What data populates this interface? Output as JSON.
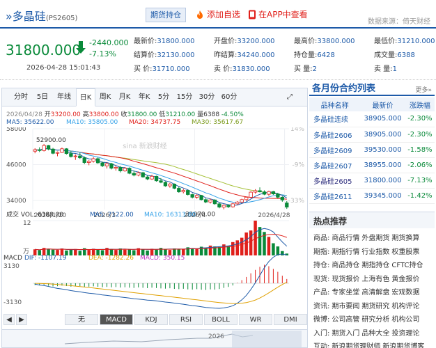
{
  "header": {
    "title": "多晶硅",
    "symbol": "(PS2605)",
    "tag": "期货持仓",
    "add": "添加自选",
    "app": "在APP中查看",
    "source": "数据来源：倚天财经"
  },
  "price": {
    "last": "31800.000",
    "change": "-2440.000",
    "pct": "-7.13%",
    "time": "2026-04-28 15:01:43"
  },
  "quotes": [
    [
      {
        "label": "最新价:",
        "value": "31800.000"
      },
      {
        "label": "开盘价:",
        "value": "33200.000"
      },
      {
        "label": "最高价:",
        "value": "33800.000"
      },
      {
        "label": "最低价:",
        "value": "31210.000"
      }
    ],
    [
      {
        "label": "结算价:",
        "value": "32130.000"
      },
      {
        "label": "昨结算:",
        "value": "34240.000"
      },
      {
        "label": "持仓量:",
        "value": "6428"
      },
      {
        "label": "成交量:",
        "value": "6388"
      }
    ],
    [
      {
        "label": "买 价:",
        "value": "31710.000"
      },
      {
        "label": "卖 价:",
        "value": "31830.000"
      },
      {
        "label": "买 量:",
        "value": "2"
      },
      {
        "label": "卖 量:",
        "value": "1"
      }
    ]
  ],
  "tabs": [
    "分时",
    "5日",
    "年线",
    "日K",
    "周K",
    "月K",
    "年K",
    "5分",
    "15分",
    "30分",
    "60分"
  ],
  "active_tab": "日K",
  "kinfo": {
    "date": "2026/04/28",
    "open_l": "开",
    "open": "33200.00",
    "high_l": "高",
    "high": "33800.00",
    "close_l": "收",
    "close": "31800.00",
    "low_l": "低",
    "low": "31210.00",
    "vol_l": "量",
    "vol": "6388",
    "pct": "-4.50%",
    "ma5": "MA5: 35622.00",
    "ma10": "MA10: 35805.00",
    "ma20": "MA20: 34737.75",
    "ma30": "MA30: 35617.67"
  },
  "vol_legend": {
    "vol": "成交 VOL: 6388.00",
    "ma5": "MA5: 7122.00",
    "ma10": "MA10: 16313.80"
  },
  "macd_legend": {
    "name": "MACD",
    "dif": "DIF: -1107.19",
    "dea": "DEA: -1282.26",
    "macd": "MACD: 350.15"
  },
  "watermark": "sina 新浪财经",
  "indicators": [
    "无",
    "MACD",
    "KDJ",
    "RSI",
    "BOLL",
    "WR",
    "DMI"
  ],
  "active_indicator": "MACD",
  "nav_year": "2026",
  "chart_data": {
    "type": "candlestick",
    "price_axis": {
      "ticks": [
        "58000",
        "46000",
        "34000"
      ],
      "pct_ticks": [
        "14%",
        "-9%",
        "-33%"
      ]
    },
    "x_ticks": [
      "2026/1/20",
      "2026/3",
      "2026/4",
      "2026/4/28"
    ],
    "annotations": [
      {
        "text": "52900.00"
      },
      {
        "text": "31070.00"
      }
    ],
    "vol_axis": {
      "ticks": [
        "12",
        "万"
      ]
    },
    "macd_axis": {
      "ticks": [
        "3130",
        "0",
        "-3130"
      ]
    },
    "candles": [
      [
        50500,
        51500,
        49800,
        51000
      ],
      [
        51000,
        51800,
        50200,
        50700
      ],
      [
        50700,
        52900,
        50400,
        52400
      ],
      [
        52400,
        52600,
        50800,
        51200
      ],
      [
        51200,
        51600,
        49500,
        49800
      ],
      [
        49800,
        50400,
        48800,
        50100
      ],
      [
        50100,
        51700,
        49900,
        51300
      ],
      [
        51300,
        51500,
        49400,
        49700
      ],
      [
        49700,
        50600,
        48400,
        48700
      ],
      [
        48700,
        49400,
        47600,
        48900
      ],
      [
        48900,
        50000,
        47900,
        48300
      ],
      [
        48300,
        48700,
        46200,
        46700
      ],
      [
        46700,
        47500,
        45800,
        47100
      ],
      [
        47100,
        48500,
        46700,
        48000
      ],
      [
        48000,
        48400,
        46300,
        46600
      ],
      [
        46600,
        47000,
        45200,
        45600
      ],
      [
        45600,
        46800,
        44700,
        46300
      ],
      [
        46300,
        46600,
        44400,
        44800
      ],
      [
        44800,
        45700,
        44000,
        45100
      ],
      [
        45100,
        45500,
        43400,
        43900
      ],
      [
        43900,
        45200,
        43600,
        44800
      ],
      [
        44800,
        45100,
        42800,
        43100
      ],
      [
        43100,
        44000,
        42100,
        42500
      ],
      [
        42500,
        43700,
        42100,
        43300
      ],
      [
        43300,
        43600,
        41600,
        41900
      ],
      [
        41900,
        42400,
        40800,
        41200
      ],
      [
        41200,
        42600,
        40900,
        42100
      ],
      [
        42100,
        42300,
        40300,
        40600
      ],
      [
        40600,
        41500,
        39800,
        40100
      ],
      [
        40100,
        40400,
        38600,
        38900
      ],
      [
        38900,
        39900,
        38300,
        39500
      ],
      [
        39500,
        39700,
        37800,
        38100
      ],
      [
        38100,
        38600,
        36600,
        36900
      ],
      [
        36900,
        37900,
        36400,
        37400
      ],
      [
        37400,
        37600,
        35700,
        36000
      ],
      [
        36000,
        36300,
        34700,
        35100
      ],
      [
        35100,
        36100,
        34600,
        35700
      ],
      [
        35700,
        35900,
        34000,
        34300
      ],
      [
        34300,
        34700,
        33100,
        33500
      ],
      [
        33500,
        34600,
        33000,
        34200
      ],
      [
        34200,
        34400,
        32600,
        32900
      ],
      [
        32900,
        33200,
        31400,
        31800
      ],
      [
        31800,
        32700,
        31070,
        32400
      ],
      [
        32400,
        32700,
        31500,
        31900
      ],
      [
        31900,
        33200,
        31600,
        32900
      ],
      [
        32900,
        33800,
        32600,
        33500
      ],
      [
        33500,
        34600,
        33100,
        34300
      ],
      [
        34300,
        35300,
        33900,
        35100
      ],
      [
        35100,
        37100,
        34800,
        36800
      ],
      [
        36800,
        37800,
        36300,
        37300
      ],
      [
        37300,
        38400,
        36700,
        36900
      ],
      [
        36900,
        37400,
        35800,
        36100
      ],
      [
        36100,
        37300,
        35600,
        37000
      ],
      [
        37000,
        37200,
        35900,
        36200
      ],
      [
        36200,
        36600,
        34700,
        35100
      ],
      [
        35100,
        35400,
        33600,
        34200
      ],
      [
        33200,
        33800,
        31210,
        31800
      ]
    ],
    "volumes": [
      2.1,
      1.8,
      2.6,
      2.3,
      2.0,
      1.9,
      2.4,
      1.7,
      2.0,
      2.2,
      1.6,
      2.5,
      1.9,
      2.3,
      2.0,
      1.8,
      2.6,
      2.1,
      1.9,
      2.4,
      2.0,
      2.2,
      1.8,
      2.5,
      2.1,
      1.7,
      2.3,
      2.0,
      2.6,
      2.2,
      1.9,
      2.4,
      2.1,
      2.3,
      2.8,
      2.5,
      2.2,
      3.0,
      2.7,
      3.4,
      3.1,
      2.9,
      3.8,
      3.3,
      4.6,
      5.2,
      6.1,
      7.9,
      8.6,
      12.0,
      9.8,
      8.1,
      6.4,
      4.2,
      3.1,
      1.5,
      0.64
    ],
    "macd_hist": [
      -150,
      -180,
      -120,
      -200,
      -260,
      -240,
      -190,
      -230,
      -280,
      -260,
      -240,
      -300,
      -280,
      -250,
      -290,
      -320,
      -300,
      -330,
      -310,
      -350,
      -330,
      -360,
      -380,
      -340,
      -370,
      -400,
      -360,
      -390,
      -420,
      -440,
      -410,
      -460,
      -480,
      -450,
      -500,
      -520,
      -480,
      -530,
      -550,
      -500,
      -520,
      -470,
      -380,
      -300,
      -180,
      40,
      260,
      520,
      820,
      1100,
      1350,
      1520,
      1400,
      1180,
      940,
      620,
      350
    ]
  },
  "side": {
    "title": "各月份合约列表",
    "more": "更多»",
    "headers": [
      "品种名称",
      "最新价",
      "涨跌幅"
    ],
    "rows": [
      {
        "name": "多晶硅连续",
        "price": "38905.000",
        "pct": "-2.30%"
      },
      {
        "name": "多晶硅2606",
        "price": "38905.000",
        "pct": "-2.30%"
      },
      {
        "name": "多晶硅2609",
        "price": "39530.000",
        "pct": "-1.58%"
      },
      {
        "name": "多晶硅2607",
        "price": "38955.000",
        "pct": "-2.06%"
      },
      {
        "name": "多晶硅2605",
        "price": "31800.000",
        "pct": "-7.13%"
      },
      {
        "name": "多晶硅2611",
        "price": "39345.000",
        "pct": "-1.42%"
      }
    ],
    "hot_title": "热点推荐",
    "hot": [
      {
        "k": "商品:",
        "items": [
          "商品行情",
          "外盘期货",
          "期货换算"
        ]
      },
      {
        "k": "期指:",
        "items": [
          "期指行情",
          "行业指数",
          "权重股票"
        ]
      },
      {
        "k": "持仓:",
        "items": [
          "商品持仓",
          "期指持仓",
          "CFTC持仓"
        ]
      },
      {
        "k": "现货:",
        "items": [
          "现货报价",
          "上海有色",
          "黄金报价"
        ]
      },
      {
        "k": "产品:",
        "items": [
          "专家坐堂",
          "高清解盘",
          "宏观数据"
        ]
      },
      {
        "k": "资讯:",
        "items": [
          "期市要闻",
          "期货研究",
          "机构评论"
        ]
      },
      {
        "k": "微博:",
        "items": [
          "公司高管",
          "研究分析",
          "机构公司"
        ]
      },
      {
        "k": "入门:",
        "items": [
          "期货入门",
          "品种大全",
          "投资理论"
        ]
      },
      {
        "k": "互动:",
        "items": [
          "新浪期货理财师",
          "新浪期货博客"
        ]
      }
    ]
  }
}
